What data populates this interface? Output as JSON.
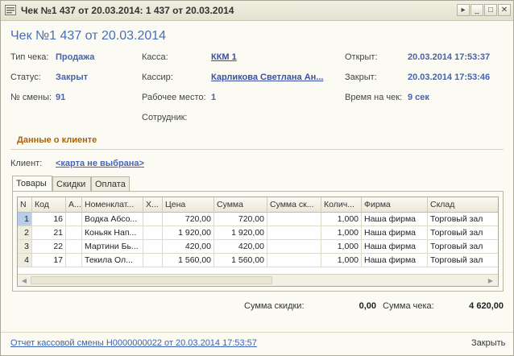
{
  "window": {
    "title": "Чек №1 437 от 20.03.2014: 1 437 от 20.03.2014"
  },
  "heading": "Чек №1 437 от 20.03.2014",
  "fields": {
    "type_label": "Тип чека:",
    "type_value": "Продажа",
    "status_label": "Статус:",
    "status_value": "Закрыт",
    "shift_label": "№ смены:",
    "shift_value": "91",
    "kassa_label": "Касса:",
    "kassa_value": "ККМ 1",
    "cashier_label": "Кассир:",
    "cashier_value": "Карликова Светлана Ан...",
    "workplace_label": "Рабочее место:",
    "workplace_value": "1",
    "employee_label": "Сотрудник:",
    "opened_label": "Открыт:",
    "opened_value": "20.03.2014 17:53:37",
    "closed_label": "Закрыт:",
    "closed_value": "20.03.2014 17:53:46",
    "duration_label": "Время на чек:",
    "duration_value": "9 сек"
  },
  "client_section": {
    "title": "Данные о клиенте",
    "client_label": "Клиент:",
    "client_value": "<карта не выбрана>"
  },
  "tabs": [
    "Товары",
    "Скидки",
    "Оплата"
  ],
  "table": {
    "columns": [
      "N",
      "Код",
      "А...",
      "Номенклат...",
      "Х...",
      "Цена",
      "Сумма",
      "Сумма ск...",
      "Колич...",
      "Фирма",
      "Склад"
    ],
    "rows": [
      [
        "1",
        "16",
        "",
        "Водка Абсо...",
        "",
        "720,00",
        "720,00",
        "",
        "1,000",
        "Наша фирма",
        "Торговый зал"
      ],
      [
        "2",
        "21",
        "",
        "Коньяк Нап...",
        "",
        "1 920,00",
        "1 920,00",
        "",
        "1,000",
        "Наша фирма",
        "Торговый зал"
      ],
      [
        "3",
        "22",
        "",
        "Мартини Бь...",
        "",
        "420,00",
        "420,00",
        "",
        "1,000",
        "Наша фирма",
        "Торговый зал"
      ],
      [
        "4",
        "17",
        "",
        "Текила Ол...",
        "",
        "1 560,00",
        "1 560,00",
        "",
        "1,000",
        "Наша фирма",
        "Торговый зал"
      ]
    ]
  },
  "totals": {
    "discount_label": "Сумма скидки:",
    "discount_value": "0,00",
    "total_label": "Сумма чека:",
    "total_value": "4 620,00"
  },
  "footer": {
    "report_link": "Отчет кассовой смены Н0000000022 от 20.03.2014 17:53:57",
    "close_label": "Закрыть"
  },
  "colors": {
    "accent_blue": "#4a6fb4",
    "section_orange": "#a7630d",
    "link_blue": "#3b63b8"
  },
  "icons": {
    "app": "receipt-app-icon",
    "menu": "menu-arrow-icon",
    "minimize": "minimize-icon",
    "maximize": "maximize-icon",
    "close": "close-icon"
  }
}
